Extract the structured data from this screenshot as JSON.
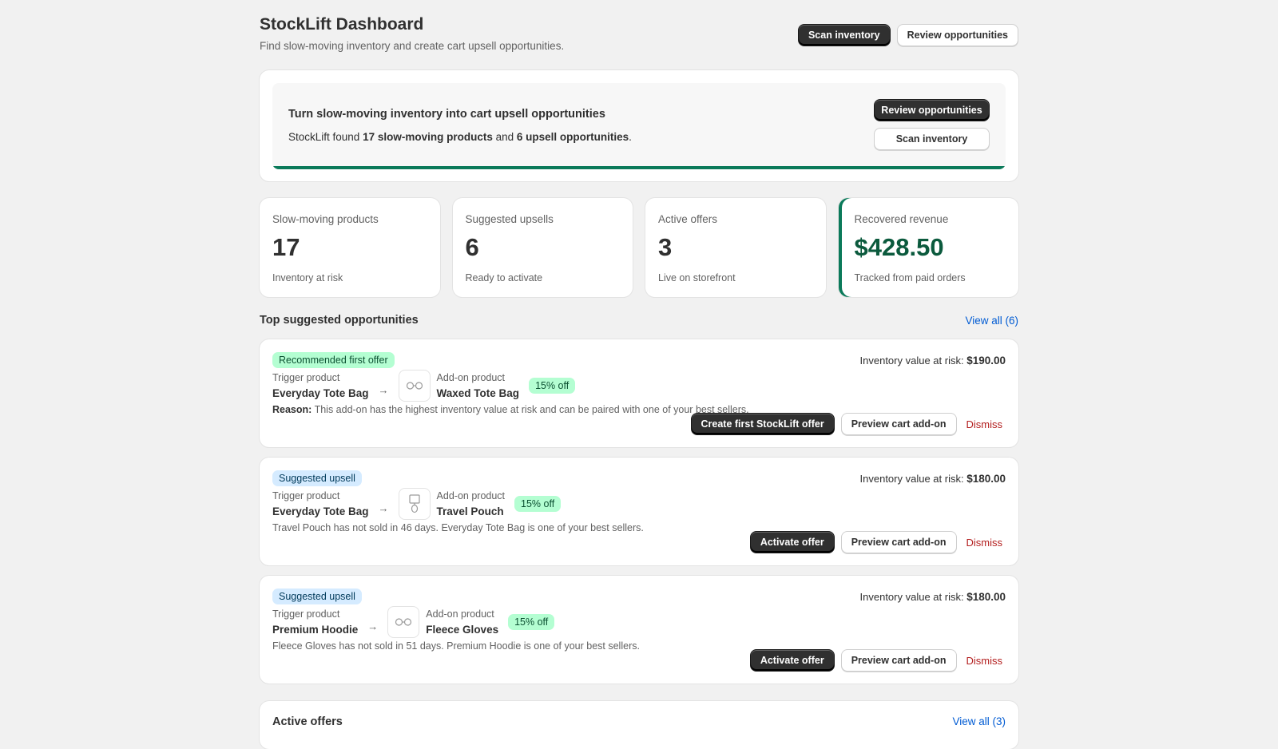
{
  "header": {
    "title": "StockLift Dashboard",
    "subtitle": "Find slow-moving inventory and create cart upsell opportunities.",
    "scan_label": "Scan inventory",
    "review_label": "Review opportunities"
  },
  "banner": {
    "title": "Turn slow-moving inventory into cart upsell opportunities",
    "text_prefix": "StockLift found ",
    "slow_count_text": "17 slow-moving products",
    "text_mid": " and ",
    "upsell_count_text": "6 upsell opportunities",
    "text_suffix": ".",
    "review_label": "Review opportunities",
    "scan_label": "Scan inventory"
  },
  "stats": [
    {
      "label": "Slow-moving products",
      "value": "17",
      "sub": "Inventory at risk"
    },
    {
      "label": "Suggested upsells",
      "value": "6",
      "sub": "Ready to activate"
    },
    {
      "label": "Active offers",
      "value": "3",
      "sub": "Live on storefront"
    },
    {
      "label": "Recovered revenue",
      "value": "$428.50",
      "sub": "Tracked from paid orders"
    }
  ],
  "opportunities_section": {
    "title": "Top suggested opportunities",
    "view_all": "View all (6)"
  },
  "opportunities": [
    {
      "badge": "Recommended first offer",
      "risk_label": "Inventory value at risk: ",
      "risk_value": "$190.00",
      "trigger_label": "Trigger product",
      "trigger_name": "Everyday Tote Bag",
      "arrow": "→",
      "addon_label": "Add-on product",
      "addon_name": "Waxed Tote Bag",
      "thumb_icon": "glasses-icon",
      "discount": "15% off",
      "reason_label": "Reason:",
      "reason": " This add-on has the highest inventory value at risk and can be paired with one of your best sellers.",
      "primary_label": "Create first StockLift offer",
      "preview_label": "Preview cart add-on",
      "dismiss_label": "Dismiss"
    },
    {
      "badge": "Suggested upsell",
      "risk_label": "Inventory value at risk: ",
      "risk_value": "$180.00",
      "trigger_label": "Trigger product",
      "trigger_name": "Everyday Tote Bag",
      "arrow": "→",
      "addon_label": "Add-on product",
      "addon_name": "Travel Pouch",
      "thumb_icon": "pouch-icon",
      "discount": "15% off",
      "reason": "Travel Pouch has not sold in 46 days. Everyday Tote Bag is one of your best sellers.",
      "primary_label": "Activate offer",
      "preview_label": "Preview cart add-on",
      "dismiss_label": "Dismiss"
    },
    {
      "badge": "Suggested upsell",
      "risk_label": "Inventory value at risk: ",
      "risk_value": "$180.00",
      "trigger_label": "Trigger product",
      "trigger_name": "Premium Hoodie",
      "arrow": "→",
      "addon_label": "Add-on product",
      "addon_name": "Fleece Gloves",
      "thumb_icon": "glasses-icon",
      "discount": "15% off",
      "reason": "Fleece Gloves has not sold in 51 days. Premium Hoodie is one of your best sellers.",
      "primary_label": "Activate offer",
      "preview_label": "Preview cart add-on",
      "dismiss_label": "Dismiss"
    }
  ],
  "active_offers_section": {
    "title": "Active offers",
    "view_all": "View all (3)"
  },
  "colors": {
    "accent_green": "#0b7a5a",
    "revenue_green": "#0b5a3d",
    "link_blue": "#005bd3",
    "danger_red": "#b31d1d"
  }
}
